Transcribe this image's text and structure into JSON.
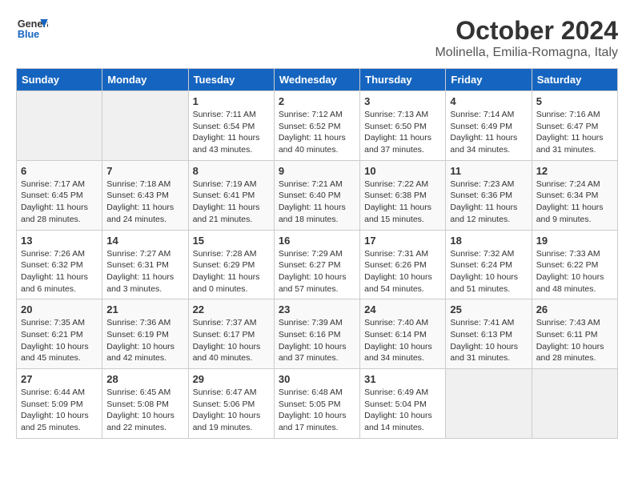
{
  "header": {
    "logo_general": "General",
    "logo_blue": "Blue",
    "title": "October 2024",
    "subtitle": "Molinella, Emilia-Romagna, Italy"
  },
  "days_of_week": [
    "Sunday",
    "Monday",
    "Tuesday",
    "Wednesday",
    "Thursday",
    "Friday",
    "Saturday"
  ],
  "weeks": [
    [
      {
        "day": "",
        "details": ""
      },
      {
        "day": "",
        "details": ""
      },
      {
        "day": "1",
        "sunrise": "Sunrise: 7:11 AM",
        "sunset": "Sunset: 6:54 PM",
        "daylight": "Daylight: 11 hours and 43 minutes."
      },
      {
        "day": "2",
        "sunrise": "Sunrise: 7:12 AM",
        "sunset": "Sunset: 6:52 PM",
        "daylight": "Daylight: 11 hours and 40 minutes."
      },
      {
        "day": "3",
        "sunrise": "Sunrise: 7:13 AM",
        "sunset": "Sunset: 6:50 PM",
        "daylight": "Daylight: 11 hours and 37 minutes."
      },
      {
        "day": "4",
        "sunrise": "Sunrise: 7:14 AM",
        "sunset": "Sunset: 6:49 PM",
        "daylight": "Daylight: 11 hours and 34 minutes."
      },
      {
        "day": "5",
        "sunrise": "Sunrise: 7:16 AM",
        "sunset": "Sunset: 6:47 PM",
        "daylight": "Daylight: 11 hours and 31 minutes."
      }
    ],
    [
      {
        "day": "6",
        "sunrise": "Sunrise: 7:17 AM",
        "sunset": "Sunset: 6:45 PM",
        "daylight": "Daylight: 11 hours and 28 minutes."
      },
      {
        "day": "7",
        "sunrise": "Sunrise: 7:18 AM",
        "sunset": "Sunset: 6:43 PM",
        "daylight": "Daylight: 11 hours and 24 minutes."
      },
      {
        "day": "8",
        "sunrise": "Sunrise: 7:19 AM",
        "sunset": "Sunset: 6:41 PM",
        "daylight": "Daylight: 11 hours and 21 minutes."
      },
      {
        "day": "9",
        "sunrise": "Sunrise: 7:21 AM",
        "sunset": "Sunset: 6:40 PM",
        "daylight": "Daylight: 11 hours and 18 minutes."
      },
      {
        "day": "10",
        "sunrise": "Sunrise: 7:22 AM",
        "sunset": "Sunset: 6:38 PM",
        "daylight": "Daylight: 11 hours and 15 minutes."
      },
      {
        "day": "11",
        "sunrise": "Sunrise: 7:23 AM",
        "sunset": "Sunset: 6:36 PM",
        "daylight": "Daylight: 11 hours and 12 minutes."
      },
      {
        "day": "12",
        "sunrise": "Sunrise: 7:24 AM",
        "sunset": "Sunset: 6:34 PM",
        "daylight": "Daylight: 11 hours and 9 minutes."
      }
    ],
    [
      {
        "day": "13",
        "sunrise": "Sunrise: 7:26 AM",
        "sunset": "Sunset: 6:32 PM",
        "daylight": "Daylight: 11 hours and 6 minutes."
      },
      {
        "day": "14",
        "sunrise": "Sunrise: 7:27 AM",
        "sunset": "Sunset: 6:31 PM",
        "daylight": "Daylight: 11 hours and 3 minutes."
      },
      {
        "day": "15",
        "sunrise": "Sunrise: 7:28 AM",
        "sunset": "Sunset: 6:29 PM",
        "daylight": "Daylight: 11 hours and 0 minutes."
      },
      {
        "day": "16",
        "sunrise": "Sunrise: 7:29 AM",
        "sunset": "Sunset: 6:27 PM",
        "daylight": "Daylight: 10 hours and 57 minutes."
      },
      {
        "day": "17",
        "sunrise": "Sunrise: 7:31 AM",
        "sunset": "Sunset: 6:26 PM",
        "daylight": "Daylight: 10 hours and 54 minutes."
      },
      {
        "day": "18",
        "sunrise": "Sunrise: 7:32 AM",
        "sunset": "Sunset: 6:24 PM",
        "daylight": "Daylight: 10 hours and 51 minutes."
      },
      {
        "day": "19",
        "sunrise": "Sunrise: 7:33 AM",
        "sunset": "Sunset: 6:22 PM",
        "daylight": "Daylight: 10 hours and 48 minutes."
      }
    ],
    [
      {
        "day": "20",
        "sunrise": "Sunrise: 7:35 AM",
        "sunset": "Sunset: 6:21 PM",
        "daylight": "Daylight: 10 hours and 45 minutes."
      },
      {
        "day": "21",
        "sunrise": "Sunrise: 7:36 AM",
        "sunset": "Sunset: 6:19 PM",
        "daylight": "Daylight: 10 hours and 42 minutes."
      },
      {
        "day": "22",
        "sunrise": "Sunrise: 7:37 AM",
        "sunset": "Sunset: 6:17 PM",
        "daylight": "Daylight: 10 hours and 40 minutes."
      },
      {
        "day": "23",
        "sunrise": "Sunrise: 7:39 AM",
        "sunset": "Sunset: 6:16 PM",
        "daylight": "Daylight: 10 hours and 37 minutes."
      },
      {
        "day": "24",
        "sunrise": "Sunrise: 7:40 AM",
        "sunset": "Sunset: 6:14 PM",
        "daylight": "Daylight: 10 hours and 34 minutes."
      },
      {
        "day": "25",
        "sunrise": "Sunrise: 7:41 AM",
        "sunset": "Sunset: 6:13 PM",
        "daylight": "Daylight: 10 hours and 31 minutes."
      },
      {
        "day": "26",
        "sunrise": "Sunrise: 7:43 AM",
        "sunset": "Sunset: 6:11 PM",
        "daylight": "Daylight: 10 hours and 28 minutes."
      }
    ],
    [
      {
        "day": "27",
        "sunrise": "Sunrise: 6:44 AM",
        "sunset": "Sunset: 5:09 PM",
        "daylight": "Daylight: 10 hours and 25 minutes."
      },
      {
        "day": "28",
        "sunrise": "Sunrise: 6:45 AM",
        "sunset": "Sunset: 5:08 PM",
        "daylight": "Daylight: 10 hours and 22 minutes."
      },
      {
        "day": "29",
        "sunrise": "Sunrise: 6:47 AM",
        "sunset": "Sunset: 5:06 PM",
        "daylight": "Daylight: 10 hours and 19 minutes."
      },
      {
        "day": "30",
        "sunrise": "Sunrise: 6:48 AM",
        "sunset": "Sunset: 5:05 PM",
        "daylight": "Daylight: 10 hours and 17 minutes."
      },
      {
        "day": "31",
        "sunrise": "Sunrise: 6:49 AM",
        "sunset": "Sunset: 5:04 PM",
        "daylight": "Daylight: 10 hours and 14 minutes."
      },
      {
        "day": "",
        "details": ""
      },
      {
        "day": "",
        "details": ""
      }
    ]
  ]
}
